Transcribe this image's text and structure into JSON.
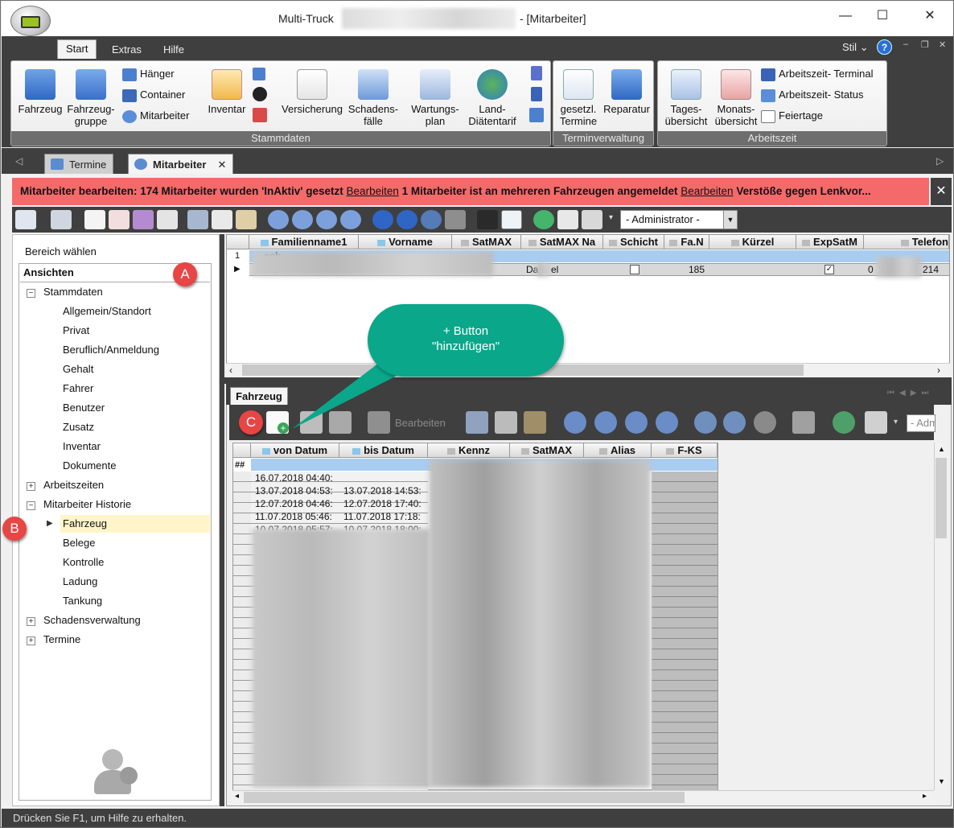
{
  "window": {
    "title_prefix": "Multi-Truck",
    "title_suffix": "- [Mitarbeiter]",
    "min_glyph": "—",
    "max_glyph": "☐",
    "close_glyph": "✕"
  },
  "ribbon_tabs": [
    "Start",
    "Extras",
    "Hilfe"
  ],
  "stil_label": "Stil",
  "help_glyph": "?",
  "ribbon": {
    "groups": {
      "stammdaten": "Stammdaten",
      "terminverwaltung": "Terminverwaltung",
      "arbeitszeit": "Arbeitszeit"
    },
    "fahrzeug": "Fahrzeug",
    "fahrzeuggruppe_1": "Fahrzeug-",
    "fahrzeuggruppe_2": "gruppe",
    "haenger": "Hänger",
    "container": "Container",
    "mitarbeiter": "Mitarbeiter",
    "inventar": "Inventar",
    "versicherung": "Versicherung",
    "schadensfaelle_1": "Schadens-",
    "schadensfaelle_2": "fälle",
    "wartungsplan_1": "Wartungs-",
    "wartungsplan_2": "plan",
    "landdiaetentarif_1": "Land-",
    "landdiaetentarif_2": "Diätentarif",
    "gesetzl_termine_1": "gesetzl.",
    "gesetzl_termine_2": "Termine",
    "reparatur": "Reparatur",
    "tagesuebersicht_1": "Tages-",
    "tagesuebersicht_2": "übersicht",
    "monatsuebersicht_1": "Monats-",
    "monatsuebersicht_2": "übersicht",
    "arbeitszeit_terminal": "Arbeitszeit- Terminal",
    "arbeitszeit_status": "Arbeitszeit- Status",
    "feiertage": "Feiertage"
  },
  "doc_tabs": [
    "Termine",
    "Mitarbeiter"
  ],
  "alert": {
    "part1": "Mitarbeiter bearbeiten: 174 Mitarbeiter wurden 'InAktiv' gesetzt",
    "link1": "Bearbeiten",
    "part2": "1 Mitarbeiter ist an mehreren Fahrzeugen angemeldet",
    "link2": "Bearbeiten",
    "part3": "Verstöße gegen Lenkvor...",
    "close": "✕"
  },
  "toolbar": {
    "user_select": "- Administrator -"
  },
  "nav": {
    "bereich": "Bereich wählen",
    "ansichten": "Ansichten",
    "stammdaten": "Stammdaten",
    "stammdaten_items": [
      "Allgemein/Standort",
      "Privat",
      "Beruflich/Anmeldung",
      "Gehalt",
      "Fahrer",
      "Benutzer",
      "Zusatz",
      "Inventar",
      "Dokumente"
    ],
    "arbeitszeiten": "Arbeitszeiten",
    "historie": "Mitarbeiter Historie",
    "historie_items": [
      "Fahrzeug",
      "Belege",
      "Kontrolle",
      "Ladung",
      "Tankung"
    ],
    "schadensverwaltung": "Schadensverwaltung",
    "termine": "Termine"
  },
  "top_grid": {
    "headers": [
      "Familienname1",
      "Vorname",
      "SatMAX",
      "SatMAX Na",
      "Schicht",
      "Fa.N",
      "Kürzel",
      "ExpSatM",
      "Telefon"
    ],
    "row1_marker": "1",
    "row1_name": "och",
    "row2_name": "chs",
    "row2_satmaxna_a": "Da",
    "row2_satmaxna_b": "el",
    "row2_fan": "185",
    "row2_tel_a": "0",
    "row2_tel_b": "214"
  },
  "fahrzeug_panel": {
    "tab": "Fahrzeug",
    "bearbeiten": "Bearbeiten",
    "user_select_partial": "- Adm",
    "headers": [
      "von Datum",
      "bis Datum",
      "Kennz",
      "SatMAX",
      "Alias",
      "F-KS"
    ],
    "filter_marker": "##",
    "rows": [
      {
        "von": "16.07.2018 04:40:",
        "bis": ""
      },
      {
        "von": "13.07.2018 04:53:",
        "bis": "13.07.2018 14:53:"
      },
      {
        "von": "12.07.2018 04:46:",
        "bis": "12.07.2018 17:40:"
      },
      {
        "von": "11.07.2018 05:46:",
        "bis": "11.07.2018 17:18:"
      },
      {
        "von": "10.07.2018 05:57:",
        "bis": "10.07.2018 18:00:"
      }
    ]
  },
  "callouts": {
    "a": "A",
    "b": "B",
    "c": "C",
    "bubble_line1": "+ Button",
    "bubble_line2": "\"hinzufügen\""
  },
  "status": "Drücken Sie F1, um Hilfe zu erhalten."
}
